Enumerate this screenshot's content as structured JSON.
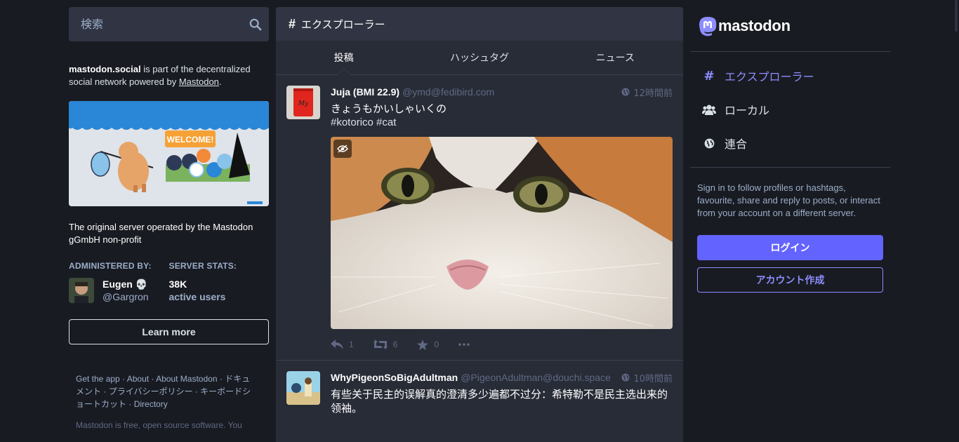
{
  "search": {
    "placeholder": "検索"
  },
  "about": {
    "server_name": "mastodon.social",
    "text_before": " is part of the decentralized social network powered by ",
    "link": "Mastodon",
    "text_after": "."
  },
  "server": {
    "description": "The original server operated by the Mastodon gGmbH non-profit",
    "admin_heading": "ADMINISTERED BY:",
    "stats_heading": "SERVER STATS:",
    "admin_name": "Eugen 💀",
    "admin_handle": "@Gargron",
    "stat_value": "38K",
    "stat_label": "active users",
    "learn_more": "Learn more"
  },
  "footer": {
    "links": [
      "Get the app",
      "About",
      "About Mastodon",
      "ドキュメント",
      "プライバシーポリシー",
      "キーボードショートカット",
      "Directory"
    ],
    "note": "Mastodon is free, open source software. You"
  },
  "column": {
    "title": "エクスプローラー",
    "tabs": [
      {
        "label": "投稿",
        "active": true
      },
      {
        "label": "ハッシュタグ",
        "active": false
      },
      {
        "label": "ニュース",
        "active": false
      }
    ]
  },
  "posts": [
    {
      "display_name": "Juja (BMI 22.9)",
      "acct": "@ymd@fedibird.com",
      "time": "12時間前",
      "content": "きょうもかいしゃいくの",
      "tags": "#kotorico #cat",
      "replies": "1",
      "boosts": "6",
      "favourites": "0"
    },
    {
      "display_name": "WhyPigeonSoBigAdultman",
      "acct": "@PigeonAdultman@douchi.space",
      "time": "10時間前",
      "content": "有些关于民主的误解真的澄清多少遍都不过分：希特勒不是民主选出来的领袖。"
    }
  ],
  "nav": {
    "logo": "mastodon",
    "items": [
      {
        "label": "エクスプローラー",
        "icon": "hash-icon",
        "active": true
      },
      {
        "label": "ローカル",
        "icon": "users-icon",
        "active": false
      },
      {
        "label": "連合",
        "icon": "globe-icon",
        "active": false
      }
    ]
  },
  "signin": {
    "text": "Sign in to follow profiles or hashtags, favourite, share and reply to posts, or interact from your account on a different server.",
    "login": "ログイン",
    "create": "アカウント作成"
  },
  "colors": {
    "background": "#191b22",
    "panel": "#282c37",
    "accent": "#6364ff",
    "accent_light": "#8c8dff",
    "muted": "#606984",
    "secondary_text": "#9baec8"
  }
}
